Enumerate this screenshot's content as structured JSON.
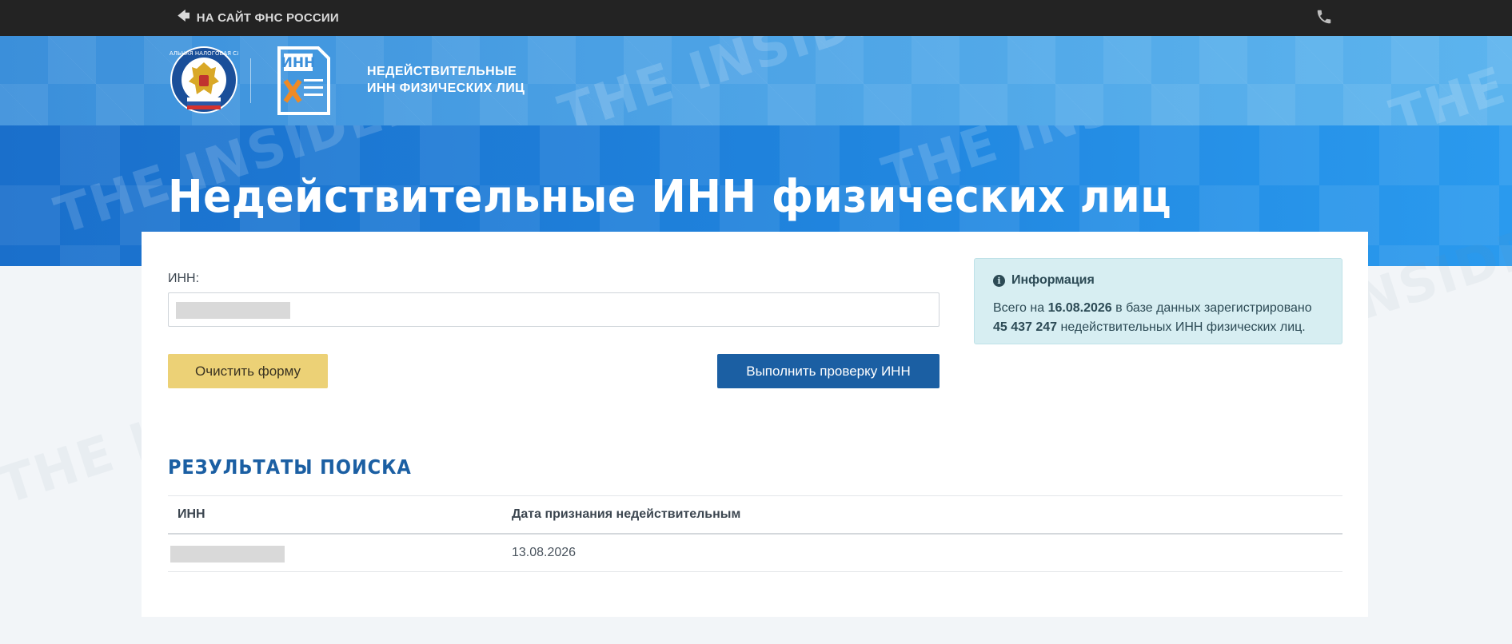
{
  "topbar": {
    "back_link": "НА САЙТ ФНС РОССИИ",
    "back_icon": "arrow-left-icon",
    "phone_icon": "phone-icon"
  },
  "header": {
    "logo_fns_text": "ФЕДЕРАЛЬНАЯ НАЛОГОВАЯ СЛУЖБА",
    "logo_inn_text": "ИНН",
    "title_line1": "НЕДЕЙСТВИТЕЛЬНЫЕ",
    "title_line2": "ИНН ФИЗИЧЕСКИХ ЛИЦ"
  },
  "hero": {
    "title": "Недействительные ИНН физических лиц"
  },
  "watermark": "THE INSIDER",
  "form": {
    "inn_label": "ИНН:",
    "inn_value": "",
    "clear_button": "Очистить форму",
    "check_button": "Выполнить проверку ИНН"
  },
  "info": {
    "title": "Информация",
    "icon": "info-circle-icon",
    "prefix": "Всего на",
    "date": "16.08.2026",
    "middle": "в базе данных зарегистрировано",
    "count": "45 437 247",
    "suffix": "недействительных ИНН физических лиц."
  },
  "results": {
    "title": "РЕЗУЛЬТАТЫ ПОИСКА",
    "columns": [
      "ИНН",
      "Дата признания недействительным"
    ],
    "rows": [
      {
        "inn": "",
        "date": "13.08.2026"
      }
    ]
  },
  "colors": {
    "topbar": "#232323",
    "header": "#4aa0e4",
    "hero": "#1f82dc",
    "accent_blue": "#1b5fa3",
    "clear_button": "#ecd176",
    "info_bg": "#d7eef2"
  }
}
